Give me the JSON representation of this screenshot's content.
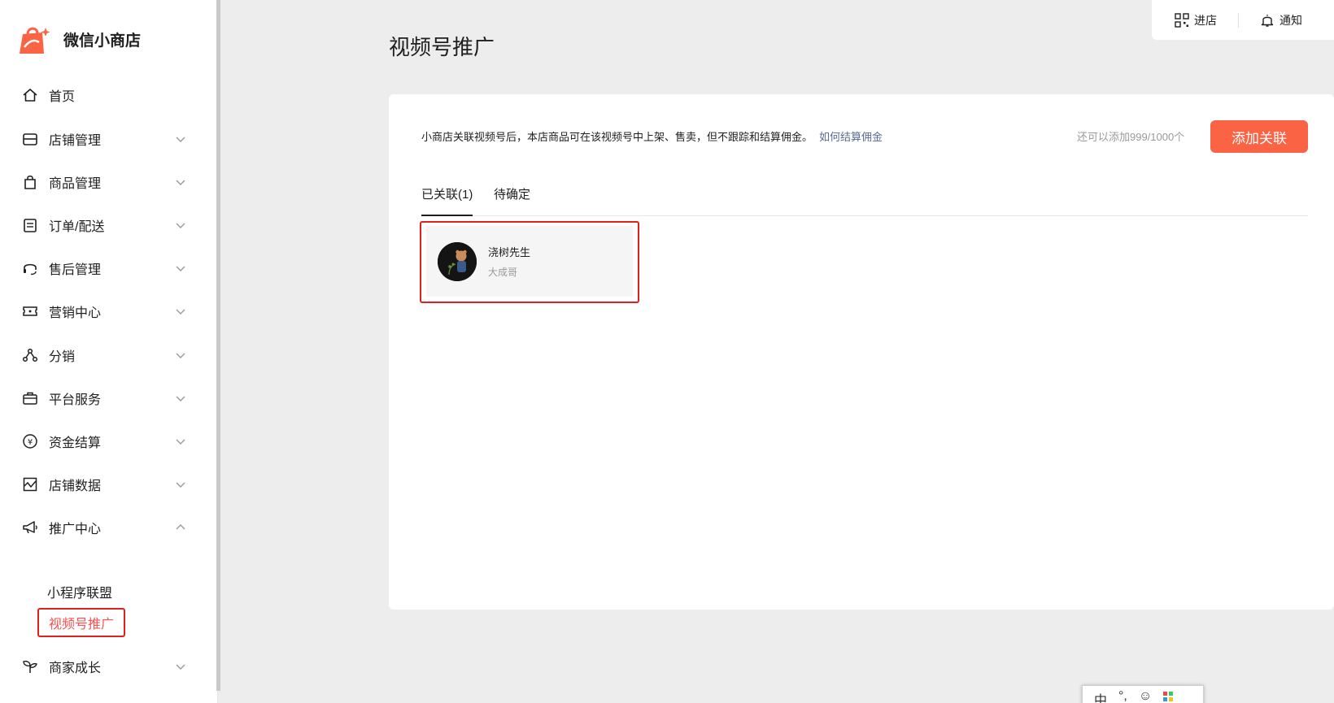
{
  "app": {
    "name": "微信小商店",
    "brand_color": "#fa6343"
  },
  "sidebar": {
    "items": [
      {
        "label": "首页",
        "icon": "home-icon",
        "has_chevron": false
      },
      {
        "label": "店铺管理",
        "icon": "shop-icon",
        "has_chevron": true
      },
      {
        "label": "商品管理",
        "icon": "bag-icon",
        "has_chevron": true
      },
      {
        "label": "订单/配送",
        "icon": "order-icon",
        "has_chevron": true
      },
      {
        "label": "售后管理",
        "icon": "headset-icon",
        "has_chevron": true
      },
      {
        "label": "营销中心",
        "icon": "ticket-icon",
        "has_chevron": true
      },
      {
        "label": "分销",
        "icon": "share-icon",
        "has_chevron": true
      },
      {
        "label": "平台服务",
        "icon": "briefcase-icon",
        "has_chevron": true
      },
      {
        "label": "资金结算",
        "icon": "yuan-icon",
        "has_chevron": true
      },
      {
        "label": "店铺数据",
        "icon": "chart-icon",
        "has_chevron": true
      },
      {
        "label": "推广中心",
        "icon": "megaphone-icon",
        "has_chevron": true,
        "expanded": true
      },
      {
        "label": "商家成长",
        "icon": "sprout-icon",
        "has_chevron": true
      }
    ],
    "sub_items": [
      {
        "label": "小程序联盟",
        "active": false
      },
      {
        "label": "视频号推广",
        "active": true
      }
    ]
  },
  "topbar": {
    "enter_shop": "进店",
    "notify": "通知"
  },
  "main": {
    "title": "视频号推广",
    "notice": "小商店关联视频号后，本店商品可在该视频号中上架、售卖，但不跟踪和结算佣金。",
    "notice_link": "如何结算佣金",
    "quota": "还可以添加999/1000个",
    "add_button": "添加关联",
    "tabs": [
      {
        "label": "已关联(1)",
        "active": true
      },
      {
        "label": "待确定",
        "active": false
      }
    ],
    "accounts": [
      {
        "name": "浇树先生",
        "sub": "大成哥"
      }
    ]
  },
  "ime": {
    "mode": "中",
    "punct": "°,",
    "emoji": "☺",
    "grid": "▦"
  }
}
